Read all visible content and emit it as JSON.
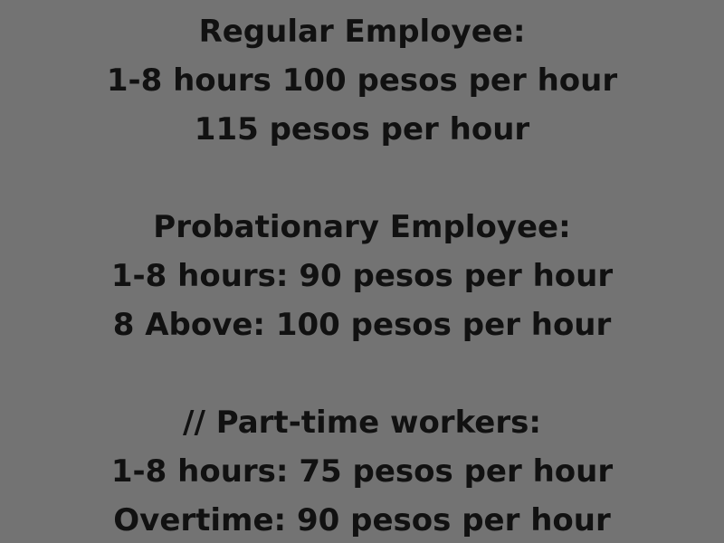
{
  "sections": [
    {
      "heading": "Regular Employee:",
      "lines": [
        "1-8 hours 100 pesos per hour",
        "115 pesos per hour"
      ]
    },
    {
      "heading": "Probationary Employee:",
      "lines": [
        "1-8 hours: 90 pesos per hour",
        "8 Above: 100 pesos per hour"
      ]
    },
    {
      "heading": "// Part-time workers:",
      "lines": [
        "1-8 hours: 75 pesos per hour",
        "Overtime: 90 pesos per hour"
      ]
    }
  ],
  "colors": {
    "background": "#737373",
    "text": "#111111"
  }
}
